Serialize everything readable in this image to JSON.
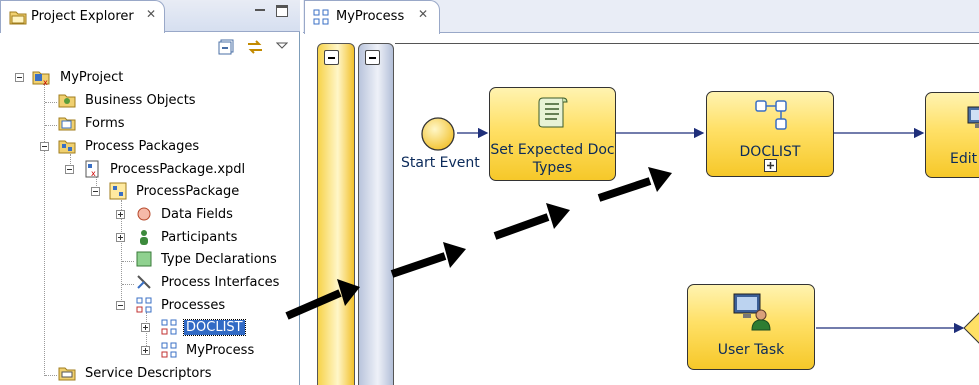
{
  "explorer": {
    "title": "Project Explorer",
    "close_glyph": "✕",
    "tree": [
      {
        "label": "MyProject",
        "icon": "project-icon"
      },
      {
        "label": "Business Objects",
        "icon": "business-objects-folder-icon"
      },
      {
        "label": "Forms",
        "icon": "forms-folder-icon"
      },
      {
        "label": "Process Packages",
        "icon": "process-packages-icon"
      },
      {
        "label": "ProcessPackage.xpdl",
        "icon": "xpdl-file-icon"
      },
      {
        "label": "ProcessPackage",
        "icon": "process-package-icon"
      },
      {
        "label": "Data Fields",
        "icon": "data-fields-icon"
      },
      {
        "label": "Participants",
        "icon": "participants-icon"
      },
      {
        "label": "Type Declarations",
        "icon": "type-declarations-icon"
      },
      {
        "label": "Process Interfaces",
        "icon": "process-interfaces-icon"
      },
      {
        "label": "Processes",
        "icon": "processes-icon"
      },
      {
        "label": "DOCLIST",
        "icon": "process-icon"
      },
      {
        "label": "MyProcess",
        "icon": "process-icon"
      },
      {
        "label": "Service Descriptors",
        "icon": "service-descriptors-icon"
      }
    ]
  },
  "editor": {
    "tab_title": "MyProcess",
    "close_glyph": "✕",
    "start_event_label": "Start Event",
    "task1_line1": "Set Expected Doc",
    "task1_line2": "Types",
    "task2_label": "DOCLIST",
    "task3_label": "Edit",
    "task4_label": "User Task"
  },
  "colors": {
    "selection": "#316ac5",
    "task_fill": "#ffe066",
    "flow_line": "#1f2f7a",
    "label_text": "#0b2a5a"
  }
}
